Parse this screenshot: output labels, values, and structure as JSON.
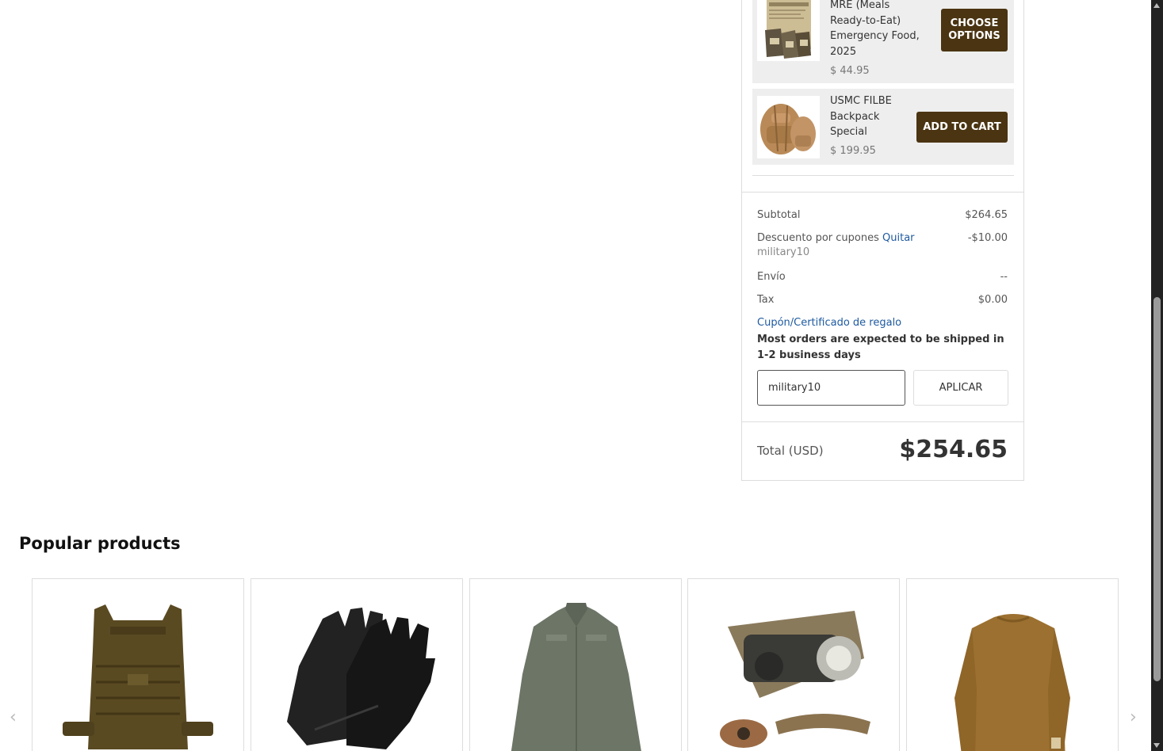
{
  "cart": {
    "items": [
      {
        "name": "MRE (Meals Ready-to-Eat) Emergency Food, 2025",
        "price": "$ 44.95",
        "button": "CHOOSE OPTIONS"
      },
      {
        "name": "USMC FILBE Backpack Special",
        "price": "$ 199.95",
        "button": "ADD TO CART"
      }
    ],
    "summary": {
      "subtotal_label": "Subtotal",
      "subtotal_value": "$264.65",
      "discount_label": "Descuento por cupones",
      "discount_remove": "Quitar",
      "discount_code": "military10",
      "discount_value": "-$10.00",
      "shipping_label": "Envío",
      "shipping_value": "--",
      "tax_label": "Tax",
      "tax_value": "$0.00",
      "coupon_link": "Cupón/Certificado de regalo",
      "shipping_notice": "Most orders are expected to be shipped in 1-2 business days",
      "coupon_input_value": "military10",
      "apply_button": "APLICAR",
      "total_label": "Total (USD)",
      "total_value": "$254.65"
    }
  },
  "popular": {
    "title": "Popular products",
    "products": [
      {
        "icon": "plate-carrier-vest-icon",
        "color": "#5a4a22"
      },
      {
        "icon": "leather-gloves-icon",
        "color": "#1e1e1e"
      },
      {
        "icon": "fleece-jacket-icon",
        "color": "#6c7566"
      },
      {
        "icon": "tactical-flashlight-icon",
        "color": "#8a7a5c"
      },
      {
        "icon": "coyote-shirt-icon",
        "color": "#9c7030"
      }
    ]
  },
  "colors": {
    "button_brown": "#4a3411",
    "link_blue": "#1e5aa0"
  }
}
